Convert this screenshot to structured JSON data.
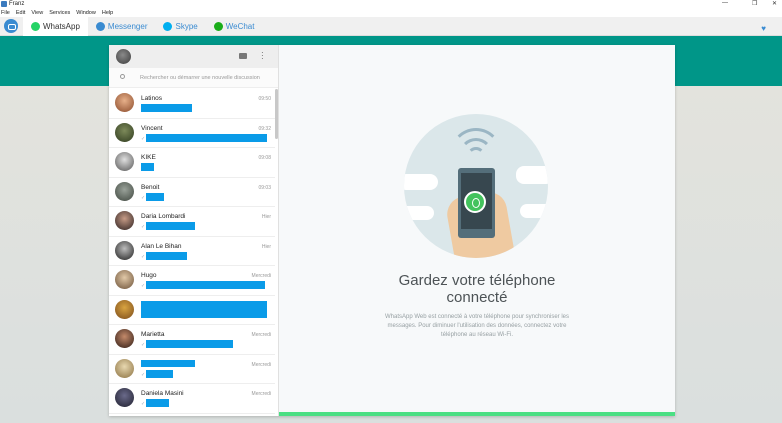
{
  "window": {
    "title": "Franz",
    "controls": [
      "—",
      "❒",
      "✕"
    ]
  },
  "menu": [
    "File",
    "Edit",
    "View",
    "Services",
    "Window",
    "Help"
  ],
  "tabs": [
    {
      "label": "WhatsApp",
      "color": "#25d366",
      "active": true
    },
    {
      "label": "Messenger",
      "color": "#3a8bd1",
      "active": false
    },
    {
      "label": "Skype",
      "color": "#00aff0",
      "active": false
    },
    {
      "label": "WeChat",
      "color": "#1aad19",
      "active": false
    }
  ],
  "colors": {
    "teal": "#009688",
    "accent": "#3a8bd1",
    "redaction": "#0a9be8",
    "progress": "#4adf83"
  },
  "sidebar": {
    "search_placeholder": "Rechercher ou démarrer une nouvelle discussion",
    "chats": [
      {
        "name": "Latinos",
        "time": "09:50"
      },
      {
        "name": "Vincent",
        "time": "09:32"
      },
      {
        "name": "KIKE",
        "time": "09:08"
      },
      {
        "name": "Benoit",
        "time": "09:03"
      },
      {
        "name": "Daria Lombardi",
        "time": "Hier"
      },
      {
        "name": "Alan Le Bihan",
        "time": "Hier"
      },
      {
        "name": "Hugo",
        "time": "Mercredi"
      },
      {
        "name": "",
        "time": ""
      },
      {
        "name": "Marietta",
        "time": "Mercredi"
      },
      {
        "name": "",
        "time": "Mercredi"
      },
      {
        "name": "Daniela Masini",
        "time": "Mercredi"
      }
    ]
  },
  "main": {
    "headline_line1": "Gardez votre téléphone",
    "headline_line2": "connecté",
    "description": "WhatsApp Web est connecté à votre téléphone pour synchroniser les messages. Pour diminuer l'utilisation des données, connectez votre téléphone au réseau Wi-Fi."
  }
}
